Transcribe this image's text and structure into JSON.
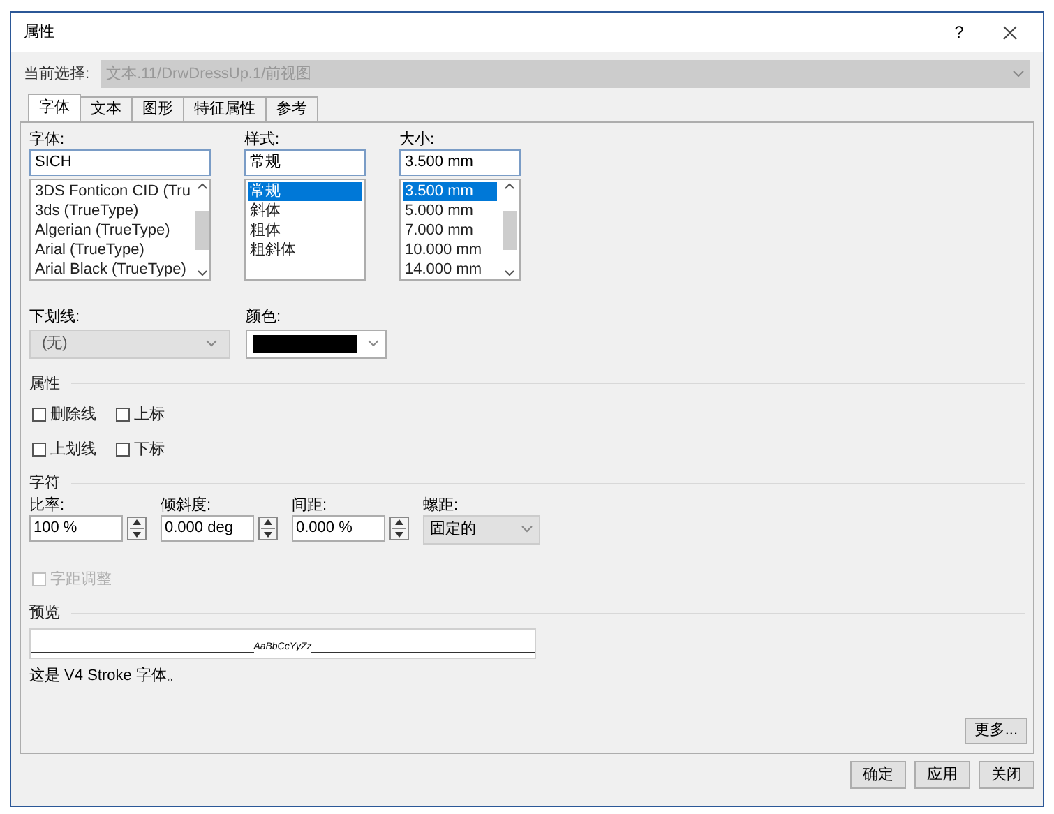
{
  "window": {
    "title": "属性",
    "help": "?"
  },
  "current_selection": {
    "label": "当前选择:",
    "value": "文本.11/DrwDressUp.1/前视图",
    "disabled": true
  },
  "tabs": [
    {
      "label": "字体",
      "selected": true
    },
    {
      "label": "文本",
      "selected": false
    },
    {
      "label": "图形",
      "selected": false
    },
    {
      "label": "特征属性",
      "selected": false
    },
    {
      "label": "参考",
      "selected": false
    }
  ],
  "lists": [
    {
      "label": "字体:",
      "value": "SICH",
      "items": [
        {
          "label": "3DS Fonticon CID (Tru",
          "selected": false
        },
        {
          "label": "3ds (TrueType)",
          "selected": false
        },
        {
          "label": "Algerian (TrueType)",
          "selected": false
        },
        {
          "label": "Arial (TrueType)",
          "selected": false
        },
        {
          "label": "Arial Black (TrueType)",
          "selected": false
        }
      ],
      "scrollbar": true
    },
    {
      "label": "样式:",
      "value": "常规",
      "items": [
        {
          "label": "常规",
          "selected": true
        },
        {
          "label": "斜体",
          "selected": false
        },
        {
          "label": "粗体",
          "selected": false
        },
        {
          "label": "粗斜体",
          "selected": false
        }
      ],
      "scrollbar": false
    },
    {
      "label": "大小:",
      "value": "3.500 mm",
      "items": [
        {
          "label": "3.500 mm",
          "selected": true
        },
        {
          "label": "5.000 mm",
          "selected": false
        },
        {
          "label": "7.000 mm",
          "selected": false
        },
        {
          "label": "10.000 mm",
          "selected": false
        },
        {
          "label": "14.000 mm",
          "selected": false
        }
      ],
      "scrollbar": true
    }
  ],
  "underline": {
    "label": "下划线:",
    "value": "(无)",
    "disabled": true
  },
  "color": {
    "label": "颜色:",
    "color": "#000000"
  },
  "attributes": {
    "title": "属性",
    "options": [
      {
        "label": "删除线",
        "checked": false
      },
      {
        "label": "上标",
        "checked": false
      },
      {
        "label": "上划线",
        "checked": false
      },
      {
        "label": "下标",
        "checked": false
      }
    ]
  },
  "characters": {
    "title": "字符",
    "fields": [
      {
        "label": "比率:",
        "value": "100 %",
        "kind": "spinner"
      },
      {
        "label": "倾斜度:",
        "value": "0.000 deg",
        "kind": "spinner"
      },
      {
        "label": "间距:",
        "value": "0.000 %",
        "kind": "spinner"
      },
      {
        "label": "螺距:",
        "value": "固定的",
        "kind": "dropdown"
      }
    ]
  },
  "kerning": {
    "label": "字距调整",
    "checked": false,
    "disabled": true
  },
  "preview": {
    "title": "预览",
    "sample": "AaBbCcYyZz",
    "description": "这是 V4 Stroke 字体。"
  },
  "buttons": {
    "more": "更多...",
    "actions": [
      "确定",
      "应用",
      "关闭"
    ]
  }
}
